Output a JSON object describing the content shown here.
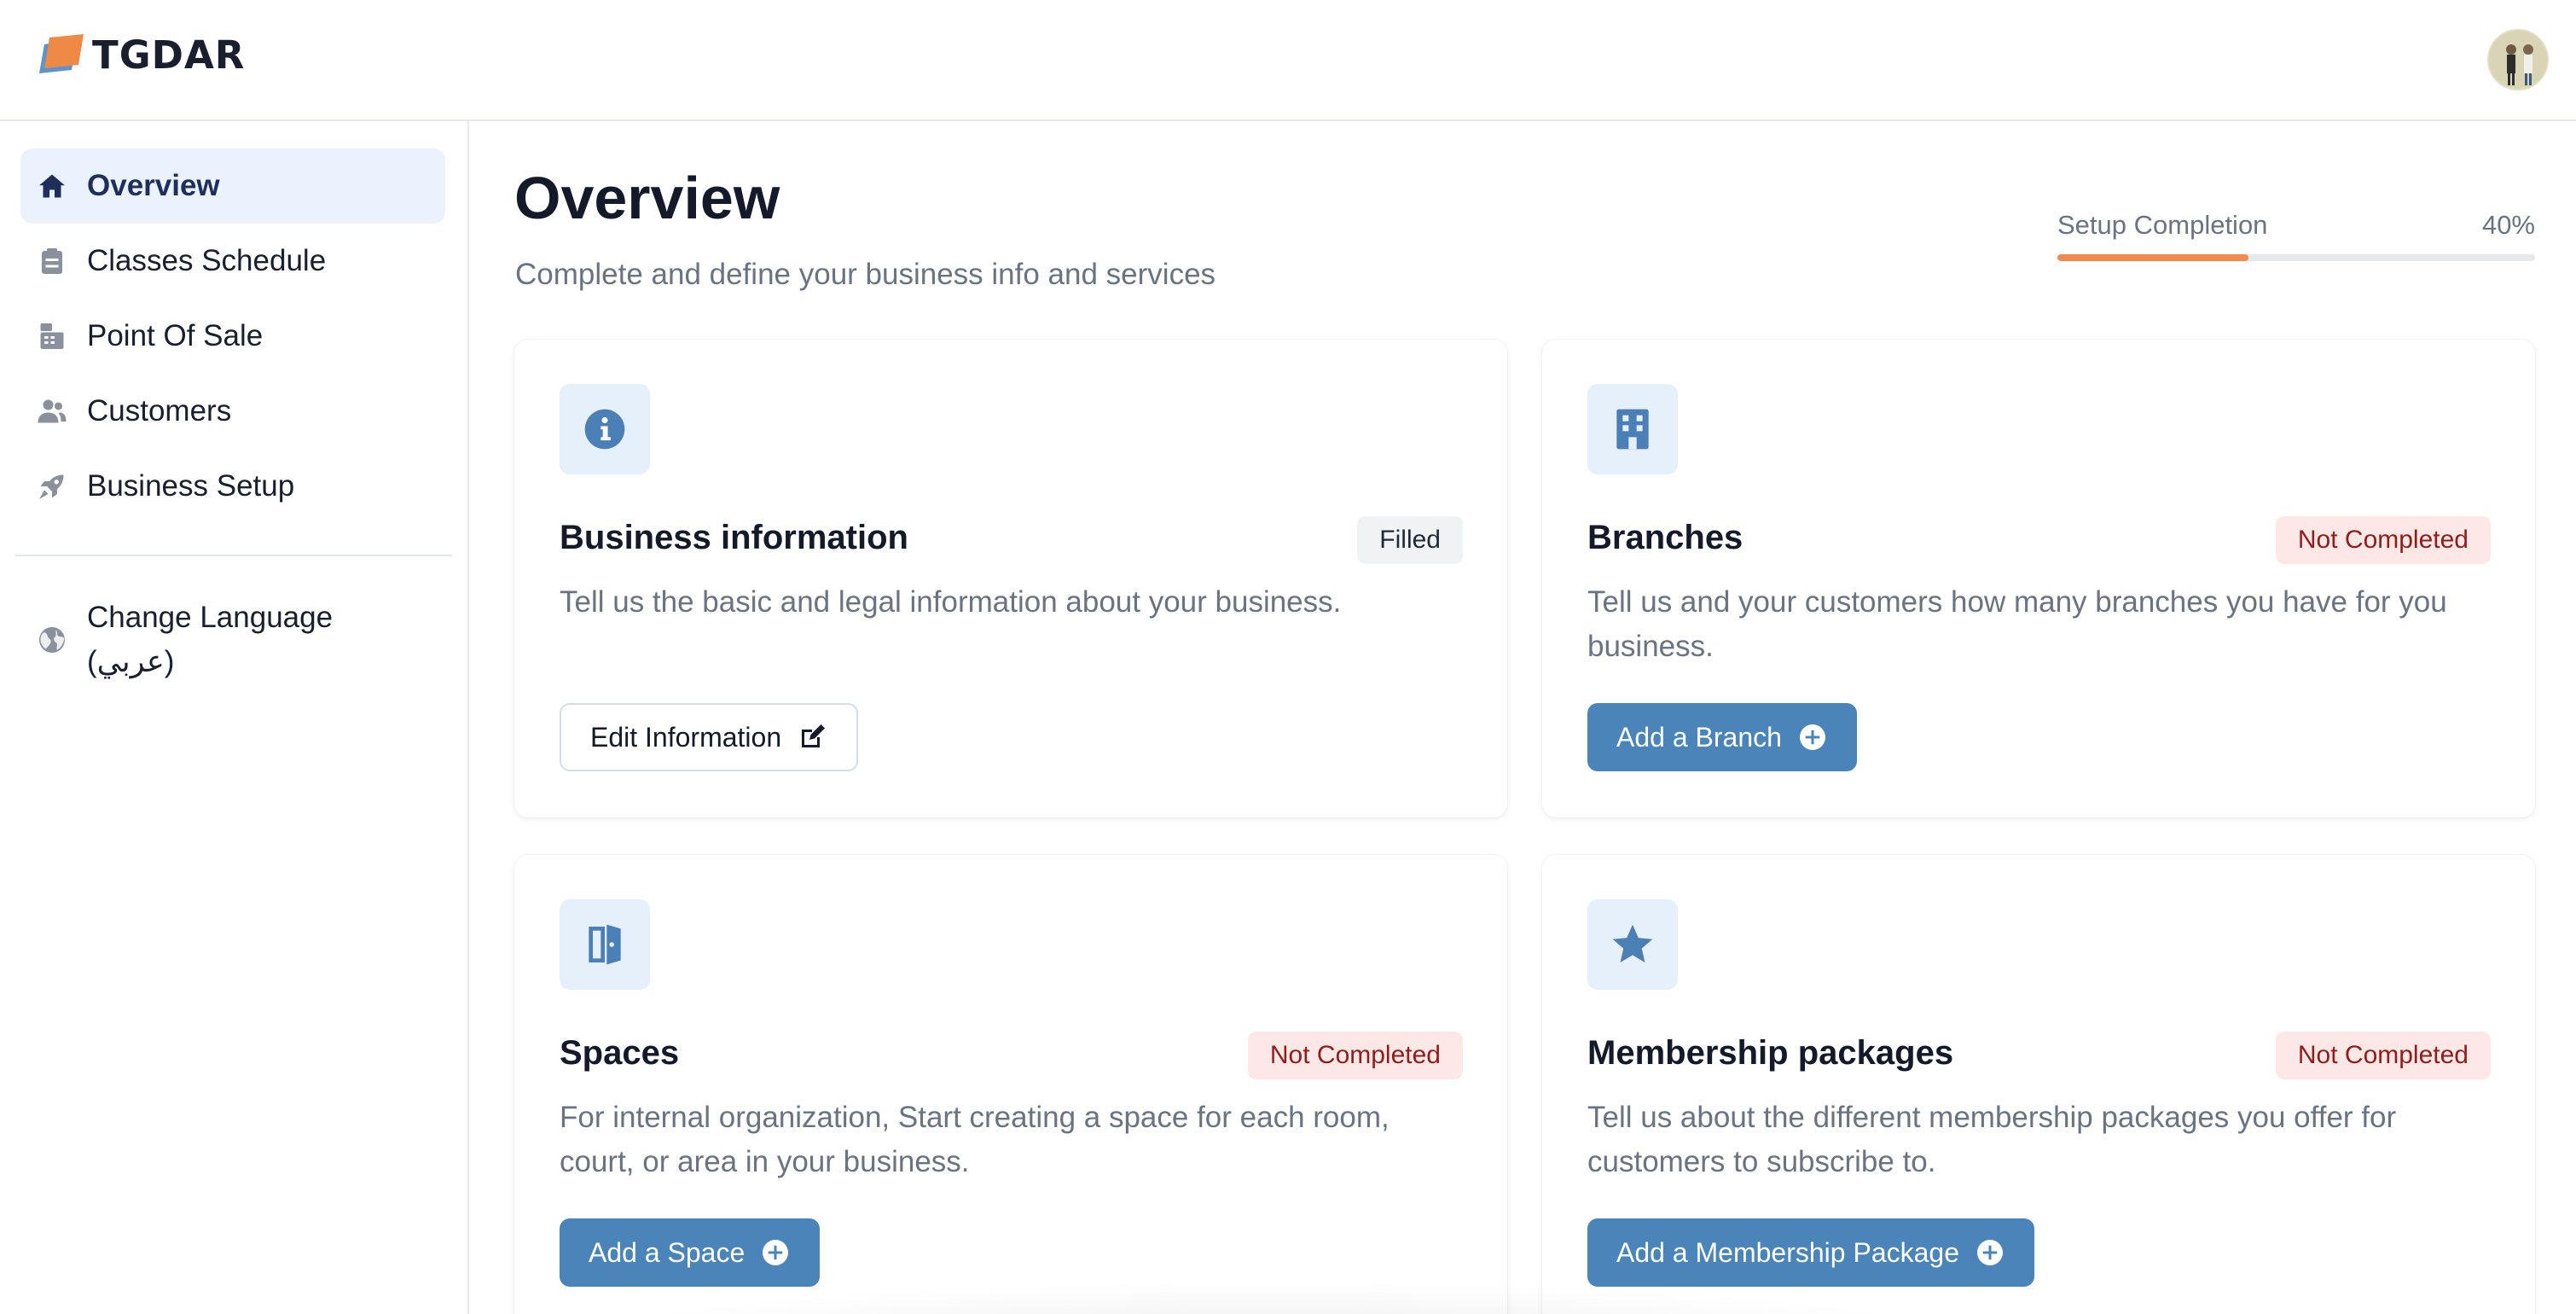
{
  "brand": {
    "name": "TGDAR",
    "logo_icon": "tgdar-logo-icon",
    "accent_color": "#ee8a45"
  },
  "header": {
    "avatar_icon": "user-avatar"
  },
  "sidebar": {
    "items": [
      {
        "label": "Overview",
        "icon": "home-icon",
        "active": true
      },
      {
        "label": "Classes Schedule",
        "icon": "clipboard-icon",
        "active": false
      },
      {
        "label": "Point Of Sale",
        "icon": "register-icon",
        "active": false
      },
      {
        "label": "Customers",
        "icon": "users-icon",
        "active": false
      },
      {
        "label": "Business Setup",
        "icon": "rocket-icon",
        "active": false
      }
    ],
    "language": {
      "line1": "Change Language",
      "line2": "(عربي)",
      "icon": "globe-icon"
    }
  },
  "page": {
    "title": "Overview",
    "subtitle": "Complete and define your business info and services",
    "progress": {
      "label": "Setup Completion",
      "value_text": "40%",
      "value": 40,
      "color": "#ef8a50"
    }
  },
  "cards": [
    {
      "title": "Business information",
      "status": "Filled",
      "description": "Tell us the basic and legal information about your business.",
      "button": "Edit Information",
      "icon": "info-icon",
      "button_icon": "edit-icon"
    },
    {
      "title": "Branches",
      "status": "Not Completed",
      "description": "Tell us and your customers how many branches you have for you business.",
      "button": "Add a Branch",
      "icon": "building-icon",
      "button_icon": "plus-circle-icon"
    },
    {
      "title": "Spaces",
      "status": "Not Completed",
      "description": "For internal organization, Start creating a space for each room, court, or area in your business.",
      "button": "Add a Space",
      "icon": "door-icon",
      "button_icon": "plus-circle-icon"
    },
    {
      "title": "Membership packages",
      "status": "Not Completed",
      "description": "Tell us about the different membership packages you offer for customers to subscribe to.",
      "button": "Add a Membership Package",
      "icon": "star-icon",
      "button_icon": "plus-circle-icon"
    }
  ],
  "colors": {
    "primary_button": "#4a84b8",
    "icon_tile": "#e6f0fb",
    "icon_blue": "#4a80b6",
    "active_nav_bg": "#e9f2fd",
    "badge_not_completed_bg": "#fde8e6",
    "badge_not_completed_text": "#8f1d1d"
  }
}
